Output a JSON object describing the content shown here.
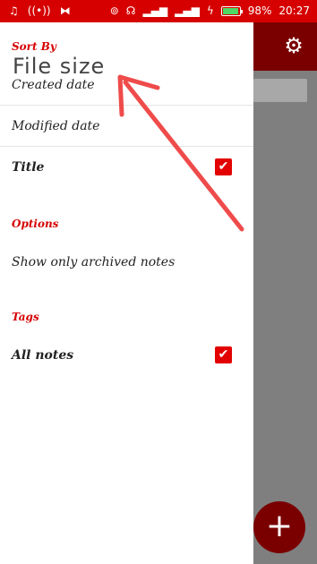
{
  "status_bar": {
    "battery": "98%",
    "time": "20:27",
    "left_icons": [
      "music-icon",
      "radio-icon",
      "notification-icon"
    ],
    "right_icons": [
      "hotspot-icon",
      "headphones-icon",
      "signal-icon",
      "signal-icon",
      "charging-icon"
    ]
  },
  "drawer": {
    "sort_header": "Sort By",
    "sort_items": [
      {
        "label": "Created date",
        "checked": false
      },
      {
        "label": "Modified date",
        "checked": false
      },
      {
        "label": "Title",
        "checked": true
      }
    ],
    "options_header": "Options",
    "options_items": [
      {
        "label": "Show only archived notes",
        "checked": false
      }
    ],
    "tags_header": "Tags",
    "tags_items": [
      {
        "label": "All notes",
        "checked": true
      }
    ]
  },
  "annotation": {
    "text": "File size",
    "color": "#ef4b4b"
  },
  "colors": {
    "primary": "#d60000",
    "check": "#e30000"
  }
}
